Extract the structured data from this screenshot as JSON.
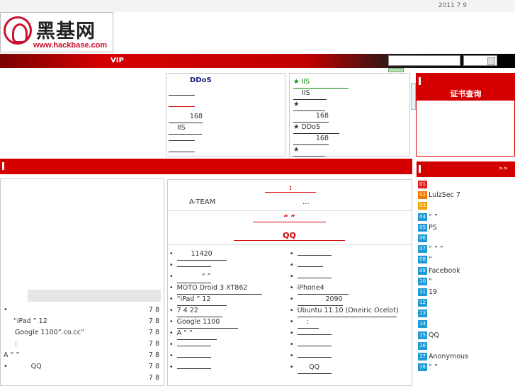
{
  "topbar": {
    "date": "2011 7 9"
  },
  "logo": {
    "cn": "黑基网",
    "url": "www.hackbase.com"
  },
  "navbar": {
    "vip": "VIP"
  },
  "certificate": {
    "label": "证书查询"
  },
  "box_ddos": {
    "title": "DDoS",
    "items": [
      "",
      "",
      "168",
      "IIS",
      "",
      ""
    ]
  },
  "box_iis": {
    "items": [
      "★ IIS",
      "IIS",
      "★",
      "168",
      "★ DDoS",
      "168",
      "★"
    ]
  },
  "headline": {
    "line1": ":",
    "ateam": "A-TEAM",
    "ellipsis": "...",
    "line2": "“ ”",
    "line3": "QQ"
  },
  "news_left": [
    "11420",
    "",
    "“ ”",
    "MOTO Droid 3 XT862",
    "“iPad ” 12",
    "7 4 22",
    "Google 1100",
    "A “ ”",
    "",
    "",
    ""
  ],
  "news_right": [
    "",
    "",
    "",
    "iPhone4",
    "2090",
    "Ubuntu 11.10 (Oneiric Ocelot)",
    ":",
    "",
    "",
    "",
    "QQ"
  ],
  "mini_list": {
    "items": [
      {
        "t": "",
        "d": "7 8"
      },
      {
        "t": "“iPad ” 12",
        "d": "7 8"
      },
      {
        "t": "Google 1100”.co.cc”",
        "d": "7 8"
      },
      {
        "t": ":",
        "d": "7 8"
      },
      {
        "t": "A “ ”",
        "d": "7 8"
      },
      {
        "t": "QQ",
        "d": "7 8"
      },
      {
        "t": "",
        "d": "7 8"
      }
    ]
  },
  "rank": {
    "more": ">>",
    "items": [
      {
        "n": "01",
        "t": ""
      },
      {
        "n": "02",
        "t": "LulzSec 7"
      },
      {
        "n": "03",
        "t": ""
      },
      {
        "n": "04",
        "t": "“ ”"
      },
      {
        "n": "05",
        "t": "PS"
      },
      {
        "n": "06",
        "t": ""
      },
      {
        "n": "07",
        "t": "“ ” “"
      },
      {
        "n": "08",
        "t": "“"
      },
      {
        "n": "09",
        "t": "Facebook"
      },
      {
        "n": "10",
        "t": "“"
      },
      {
        "n": "11",
        "t": "19"
      },
      {
        "n": "12",
        "t": ""
      },
      {
        "n": "13",
        "t": ""
      },
      {
        "n": "14",
        "t": ""
      },
      {
        "n": "15",
        "t": "QQ"
      },
      {
        "n": "16",
        "t": ""
      },
      {
        "n": "17",
        "t": "Anonymous"
      },
      {
        "n": "18",
        "t": "“ ”"
      }
    ]
  },
  "section2": {
    "more": ">>"
  },
  "colors": {
    "brand_red": "#d40000",
    "green": "#0a8a0a",
    "navy": "#1a1a80"
  }
}
